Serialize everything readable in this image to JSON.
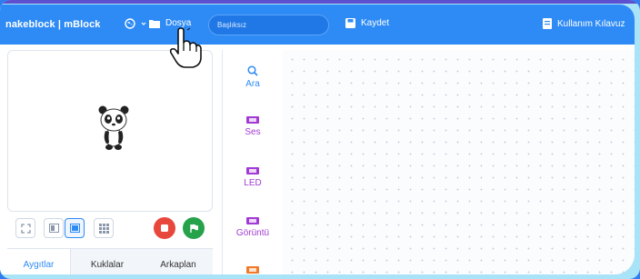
{
  "header": {
    "logo": "nakeblock | mBlock",
    "file_label": "Dosya",
    "title_input_value": "Başlıksız",
    "save_label": "Kaydet",
    "guide_label": "Kullanım Kılavuz"
  },
  "stage": {
    "sprite": "panda-sprite"
  },
  "tabs": [
    "Aygıtlar",
    "Kuklalar",
    "Arkaplan"
  ],
  "categories": [
    {
      "label": "Ara",
      "icon": "search-icon"
    },
    {
      "label": "Ses",
      "icon": "sound-block-icon"
    },
    {
      "label": "LED",
      "icon": "led-block-icon"
    },
    {
      "label": "Görüntü",
      "icon": "display-block-icon"
    }
  ],
  "colors": {
    "header": "#2e8bf5",
    "accent": "#2e8bf5",
    "stop": "#e8473c",
    "go": "#25a24a",
    "category_purple": "#a23bd3",
    "frame": "#a9e3f8"
  }
}
